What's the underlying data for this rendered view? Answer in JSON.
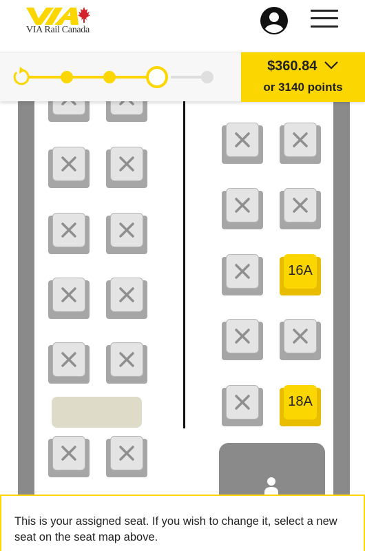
{
  "header": {
    "logo_text": "VIA Rail Canada",
    "account_icon": "account-circle-icon",
    "menu_icon": "hamburger-menu-icon"
  },
  "progress": {
    "total_steps": 5,
    "current_step": 4,
    "price": "$360.84",
    "points": "or 3140 points"
  },
  "seat_map": {
    "left_seats": [
      "unavailable",
      "unavailable",
      "unavailable",
      "unavailable",
      "unavailable",
      "unavailable",
      "unavailable",
      "unavailable",
      "unavailable",
      "unavailable",
      "unavailable",
      "unavailable"
    ],
    "right_seats": [
      {
        "status": "unavailable",
        "label": ""
      },
      {
        "status": "unavailable",
        "label": ""
      },
      {
        "status": "unavailable",
        "label": ""
      },
      {
        "status": "unavailable",
        "label": ""
      },
      {
        "status": "unavailable",
        "label": ""
      },
      {
        "status": "available",
        "label": "16A"
      },
      {
        "status": "unavailable",
        "label": ""
      },
      {
        "status": "unavailable",
        "label": ""
      },
      {
        "status": "unavailable",
        "label": ""
      },
      {
        "status": "available",
        "label": "18A"
      }
    ],
    "lavatory_icon": "person-icon"
  },
  "message": {
    "text": "This is your assigned seat. If you wish to change it, select a new seat on the seat map above."
  },
  "colors": {
    "brand_yellow": "#fcd600",
    "wall_gray": "#8a8a8a"
  }
}
